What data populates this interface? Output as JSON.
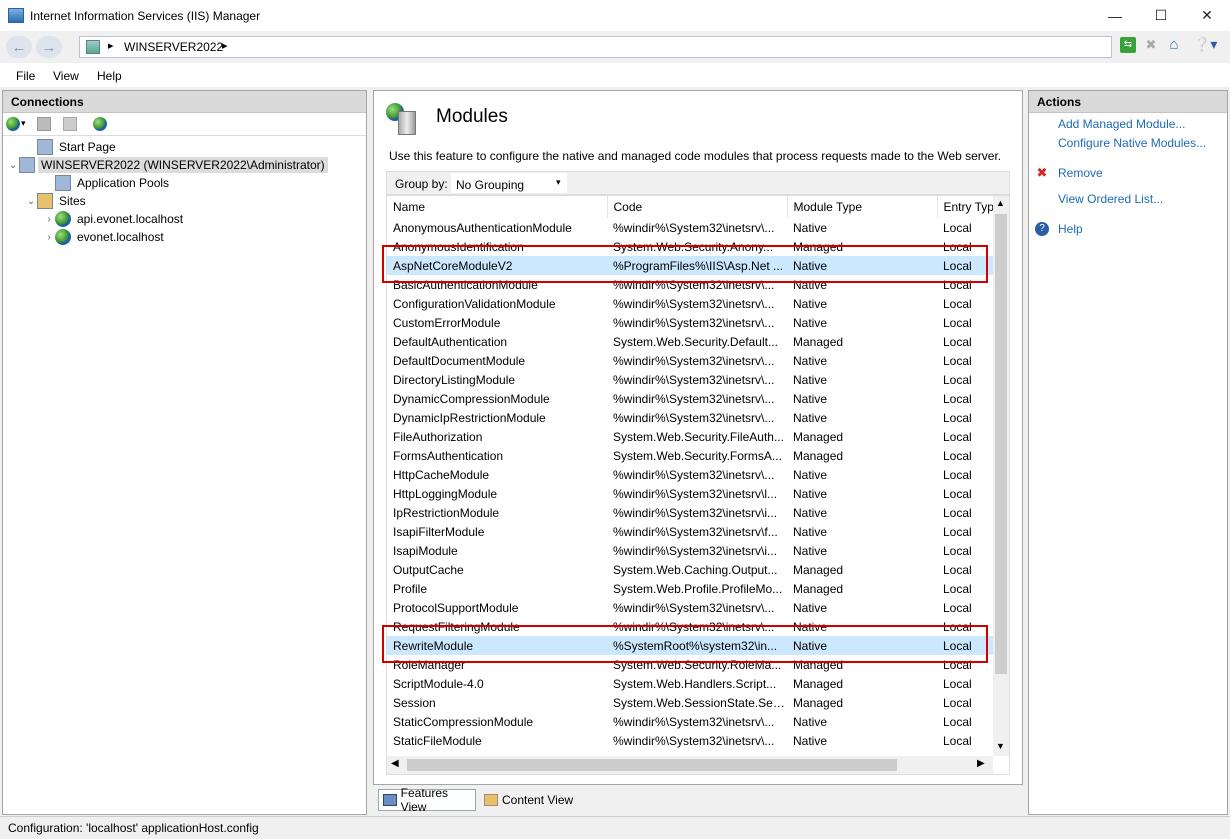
{
  "window": {
    "title": "Internet Information Services (IIS) Manager"
  },
  "address": {
    "crumb": "WINSERVER2022"
  },
  "menu": [
    "File",
    "View",
    "Help"
  ],
  "connections": {
    "header": "Connections",
    "tree": [
      {
        "label": "Start Page",
        "level": 1,
        "expand": "",
        "icon": "start-page-icon"
      },
      {
        "label": "WINSERVER2022 (WINSERVER2022\\Administrator)",
        "level": 0,
        "expand": "⌄",
        "icon": "server-icon",
        "selected": true
      },
      {
        "label": "Application Pools",
        "level": 2,
        "expand": "",
        "icon": "app-pools-icon"
      },
      {
        "label": "Sites",
        "level": 1,
        "expand": "⌄",
        "icon": "sites-folder-icon"
      },
      {
        "label": "api.evonet.localhost",
        "level": 2,
        "expand": "›",
        "icon": "globe-icon"
      },
      {
        "label": "evonet.localhost",
        "level": 2,
        "expand": "›",
        "icon": "globe-icon"
      }
    ]
  },
  "feature": {
    "title": "Modules",
    "description": "Use this feature to configure the native and managed code modules that process requests made to the Web server.",
    "group_by_label": "Group by:",
    "group_by_value": "No Grouping",
    "columns": [
      "Name",
      "Code",
      "Module Type",
      "Entry Typ"
    ],
    "rows": [
      [
        "AnonymousAuthenticationModule",
        "%windir%\\System32\\inetsrv\\...",
        "Native",
        "Local"
      ],
      [
        "AnonymousIdentification",
        "System.Web.Security.Anony...",
        "Managed",
        "Local"
      ],
      [
        "AspNetCoreModuleV2",
        "%ProgramFiles%\\IIS\\Asp.Net ...",
        "Native",
        "Local"
      ],
      [
        "BasicAuthenticationModule",
        "%windir%\\System32\\inetsrv\\...",
        "Native",
        "Local"
      ],
      [
        "ConfigurationValidationModule",
        "%windir%\\System32\\inetsrv\\...",
        "Native",
        "Local"
      ],
      [
        "CustomErrorModule",
        "%windir%\\System32\\inetsrv\\...",
        "Native",
        "Local"
      ],
      [
        "DefaultAuthentication",
        "System.Web.Security.Default...",
        "Managed",
        "Local"
      ],
      [
        "DefaultDocumentModule",
        "%windir%\\System32\\inetsrv\\...",
        "Native",
        "Local"
      ],
      [
        "DirectoryListingModule",
        "%windir%\\System32\\inetsrv\\...",
        "Native",
        "Local"
      ],
      [
        "DynamicCompressionModule",
        "%windir%\\System32\\inetsrv\\...",
        "Native",
        "Local"
      ],
      [
        "DynamicIpRestrictionModule",
        "%windir%\\System32\\inetsrv\\...",
        "Native",
        "Local"
      ],
      [
        "FileAuthorization",
        "System.Web.Security.FileAuth...",
        "Managed",
        "Local"
      ],
      [
        "FormsAuthentication",
        "System.Web.Security.FormsA...",
        "Managed",
        "Local"
      ],
      [
        "HttpCacheModule",
        "%windir%\\System32\\inetsrv\\...",
        "Native",
        "Local"
      ],
      [
        "HttpLoggingModule",
        "%windir%\\System32\\inetsrv\\l...",
        "Native",
        "Local"
      ],
      [
        "IpRestrictionModule",
        "%windir%\\System32\\inetsrv\\i...",
        "Native",
        "Local"
      ],
      [
        "IsapiFilterModule",
        "%windir%\\System32\\inetsrv\\f...",
        "Native",
        "Local"
      ],
      [
        "IsapiModule",
        "%windir%\\System32\\inetsrv\\i...",
        "Native",
        "Local"
      ],
      [
        "OutputCache",
        "System.Web.Caching.Output...",
        "Managed",
        "Local"
      ],
      [
        "Profile",
        "System.Web.Profile.ProfileMo...",
        "Managed",
        "Local"
      ],
      [
        "ProtocolSupportModule",
        "%windir%\\System32\\inetsrv\\...",
        "Native",
        "Local"
      ],
      [
        "RequestFilteringModule",
        "%windir%\\System32\\inetsrv\\...",
        "Native",
        "Local"
      ],
      [
        "RewriteModule",
        "%SystemRoot%\\system32\\in...",
        "Native",
        "Local"
      ],
      [
        "RoleManager",
        "System.Web.Security.RoleMa...",
        "Managed",
        "Local"
      ],
      [
        "ScriptModule-4.0",
        "System.Web.Handlers.Script...",
        "Managed",
        "Local"
      ],
      [
        "Session",
        "System.Web.SessionState.Ses...",
        "Managed",
        "Local"
      ],
      [
        "StaticCompressionModule",
        "%windir%\\System32\\inetsrv\\...",
        "Native",
        "Local"
      ],
      [
        "StaticFileModule",
        "%windir%\\System32\\inetsrv\\...",
        "Native",
        "Local"
      ]
    ],
    "highlighted_rows": [
      2,
      22
    ]
  },
  "views": {
    "features": "Features View",
    "content": "Content View"
  },
  "actions": {
    "header": "Actions",
    "items": [
      {
        "label": "Add Managed Module...",
        "icon": ""
      },
      {
        "label": "Configure Native Modules...",
        "icon": ""
      },
      {
        "label": "Remove",
        "icon": "remove-icon"
      },
      {
        "label": "View Ordered List...",
        "icon": ""
      },
      {
        "label": "Help",
        "icon": "help-icon"
      }
    ]
  },
  "status": {
    "text": "Configuration: 'localhost' applicationHost.config"
  },
  "colors": {
    "highlight_box": "#d00000",
    "row_selected": "#cce8ff",
    "link": "#1e6ab5"
  }
}
